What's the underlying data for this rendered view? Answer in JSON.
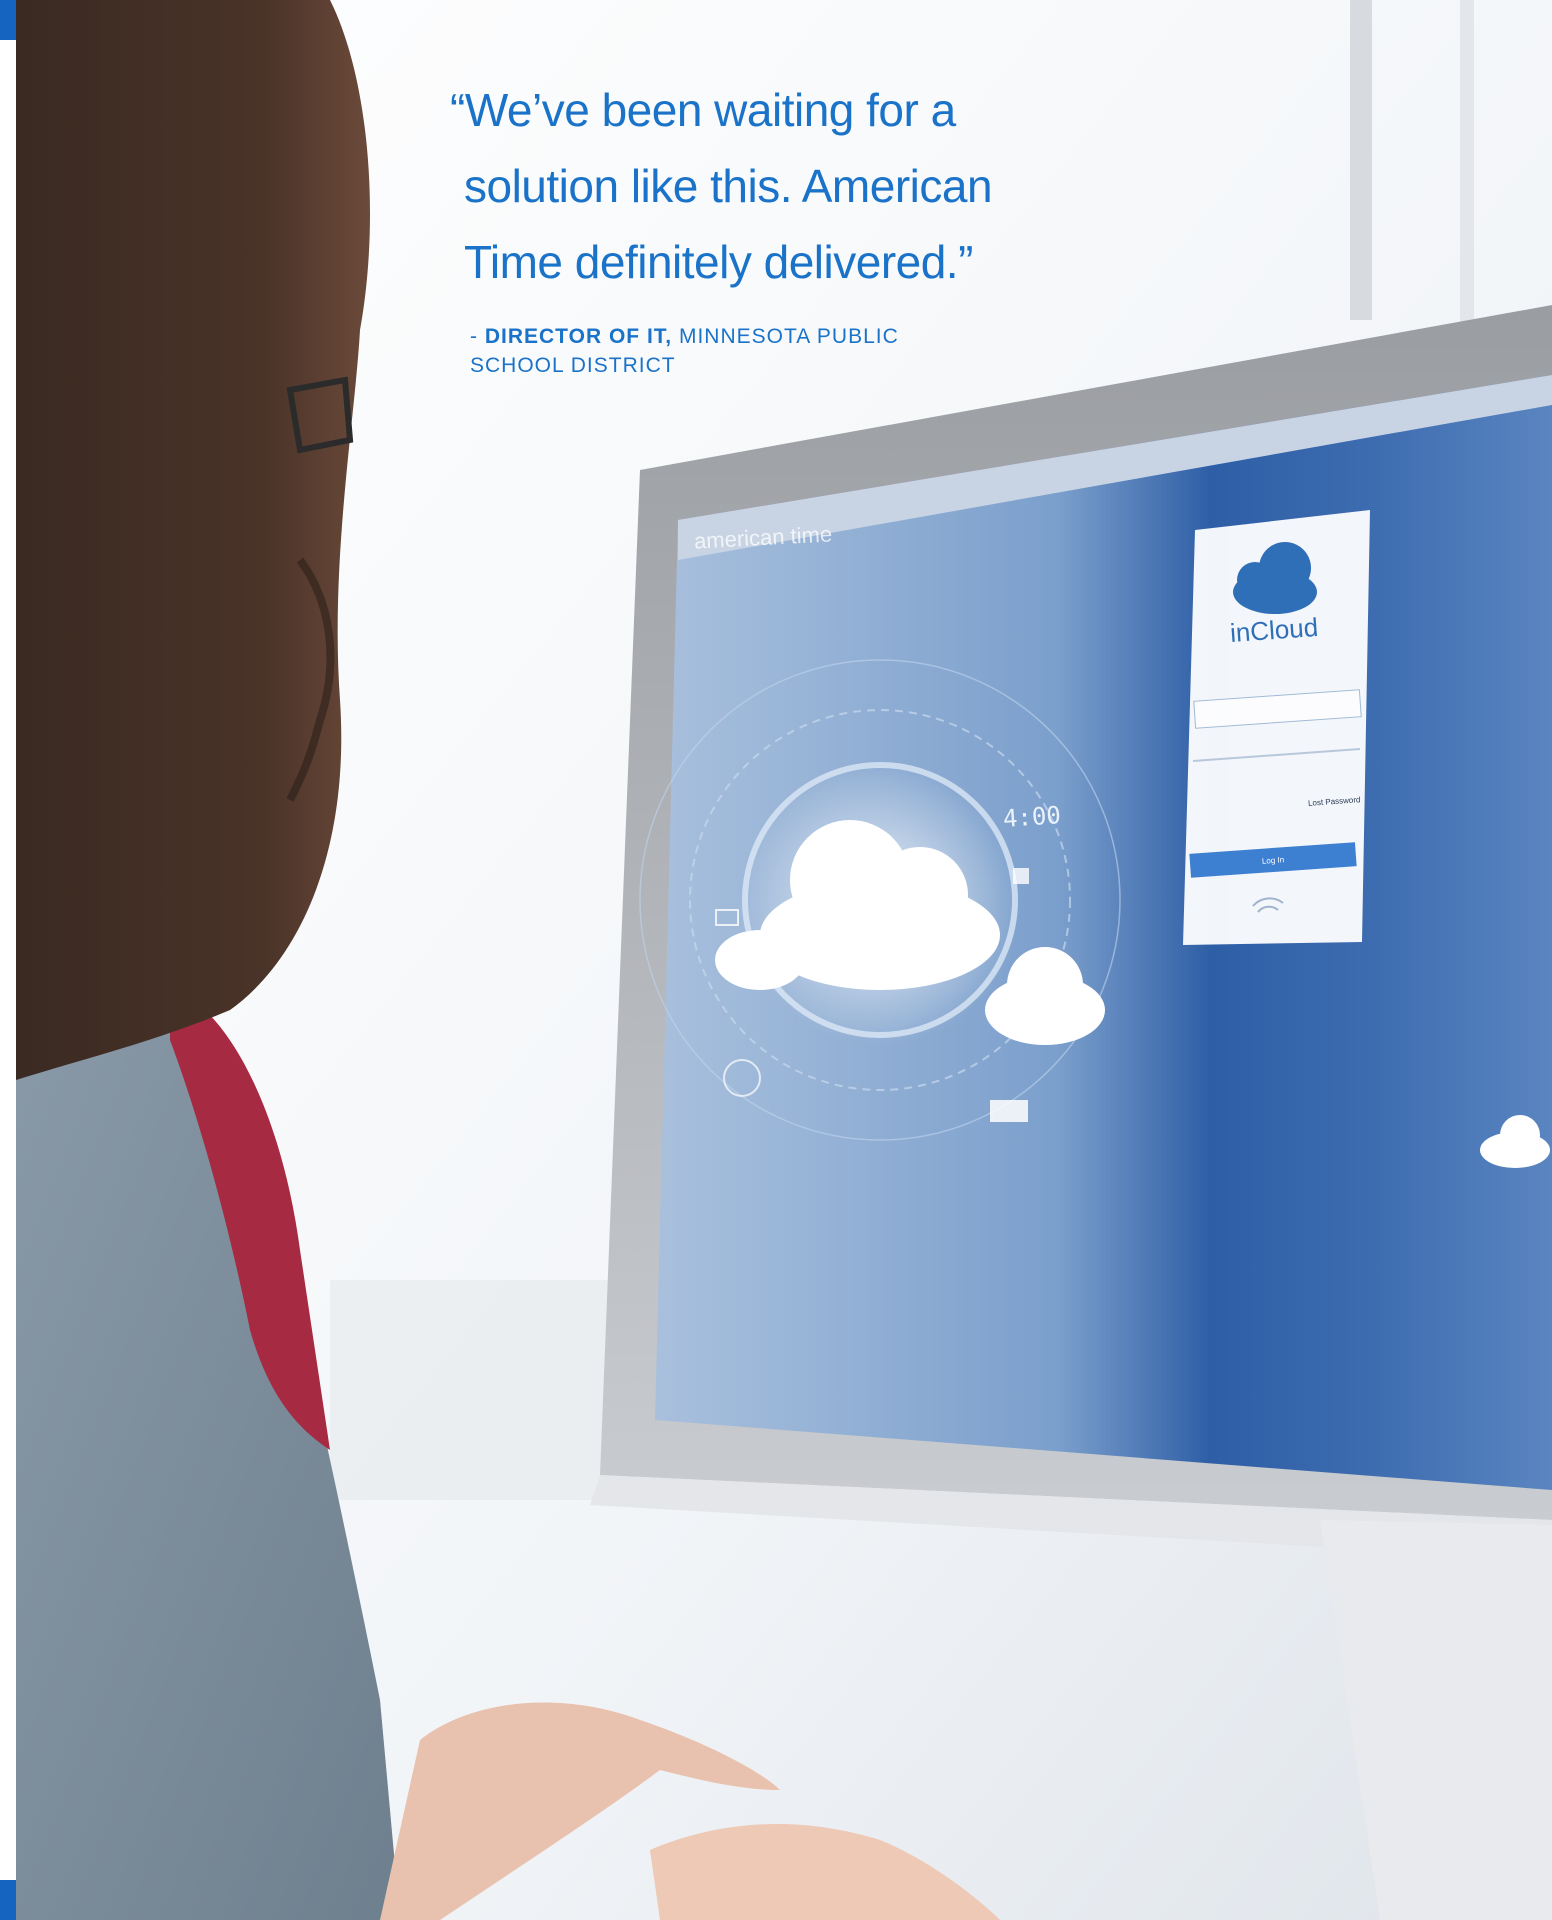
{
  "quote": {
    "lines": [
      "“We’ve been waiting for a",
      "solution like this. American",
      "Time definitely delivered.”"
    ]
  },
  "attribution": {
    "prefix": "- ",
    "role": "DIRECTOR OF IT,",
    "organization_line1": "MINNESOTA PUBLIC",
    "organization_line2": "SCHOOL DISTRICT"
  },
  "monitor": {
    "logo_text": "american time",
    "clock_text": "4:00",
    "login": {
      "brand": "inCloud",
      "lost_password_label": "Lost Password",
      "login_button_label": "Log In"
    }
  },
  "colors": {
    "accent": "#1a73c8",
    "brand_blue": "#1565c0",
    "screen_blue": "#2b5c9e"
  },
  "icons": [
    "cloud-icon",
    "clock-icon",
    "mail-icon",
    "bell-icon",
    "calendar-icon",
    "wifi-icon"
  ]
}
